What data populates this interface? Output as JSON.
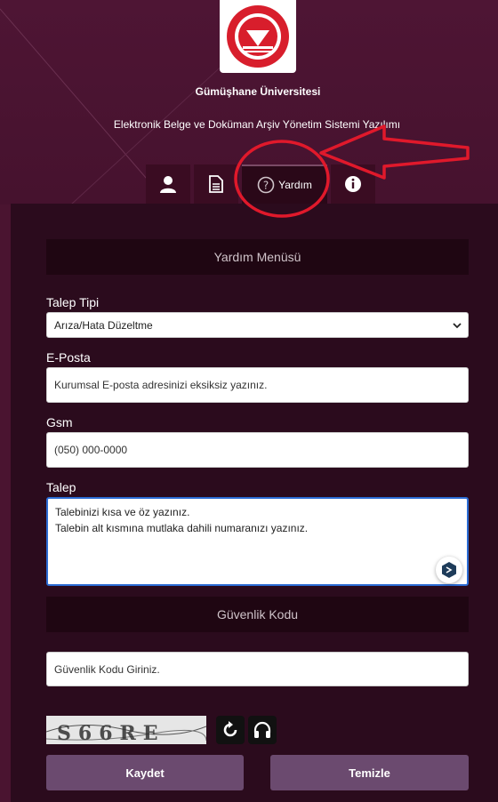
{
  "header": {
    "university_name": "Gümüşhane Üniversitesi",
    "system_name": "Elektronik Belge ve Doküman Arşiv Yönetim Sistemi Yazılımı",
    "logo_text": "GÜMÜŞHANE ÜNİVERSİTESİ",
    "logo_year": "2008"
  },
  "tabs": [
    {
      "icon": "user-icon",
      "label": ""
    },
    {
      "icon": "document-icon",
      "label": ""
    },
    {
      "icon": "question-circle-icon",
      "label": "Yardım",
      "active": true
    },
    {
      "icon": "info-circle-icon",
      "label": ""
    }
  ],
  "form": {
    "menu_header": "Yardım Menüsü",
    "request_type": {
      "label": "Talep Tipi",
      "value": "Arıza/Hata Düzeltme"
    },
    "email": {
      "label": "E-Posta",
      "placeholder": "Kurumsal E-posta adresinizi eksiksiz yazınız."
    },
    "gsm": {
      "label": "Gsm",
      "placeholder": "(050) 000-0000"
    },
    "request": {
      "label": "Talep",
      "line1": "Talebinizi kısa ve öz yazınız.",
      "line2": "Talebin alt kısmına mutlaka dahili numaranızı yazınız."
    },
    "security_header": "Güvenlik Kodu",
    "security_code": {
      "placeholder": "Güvenlik Kodu Giriniz."
    },
    "captcha_text": "S66RE",
    "save_label": "Kaydet",
    "clear_label": "Temizle"
  },
  "colors": {
    "background": "#4a1430",
    "panel": "#2b0b1d",
    "button": "#6b4a6f",
    "annotation": "#e0192b"
  }
}
